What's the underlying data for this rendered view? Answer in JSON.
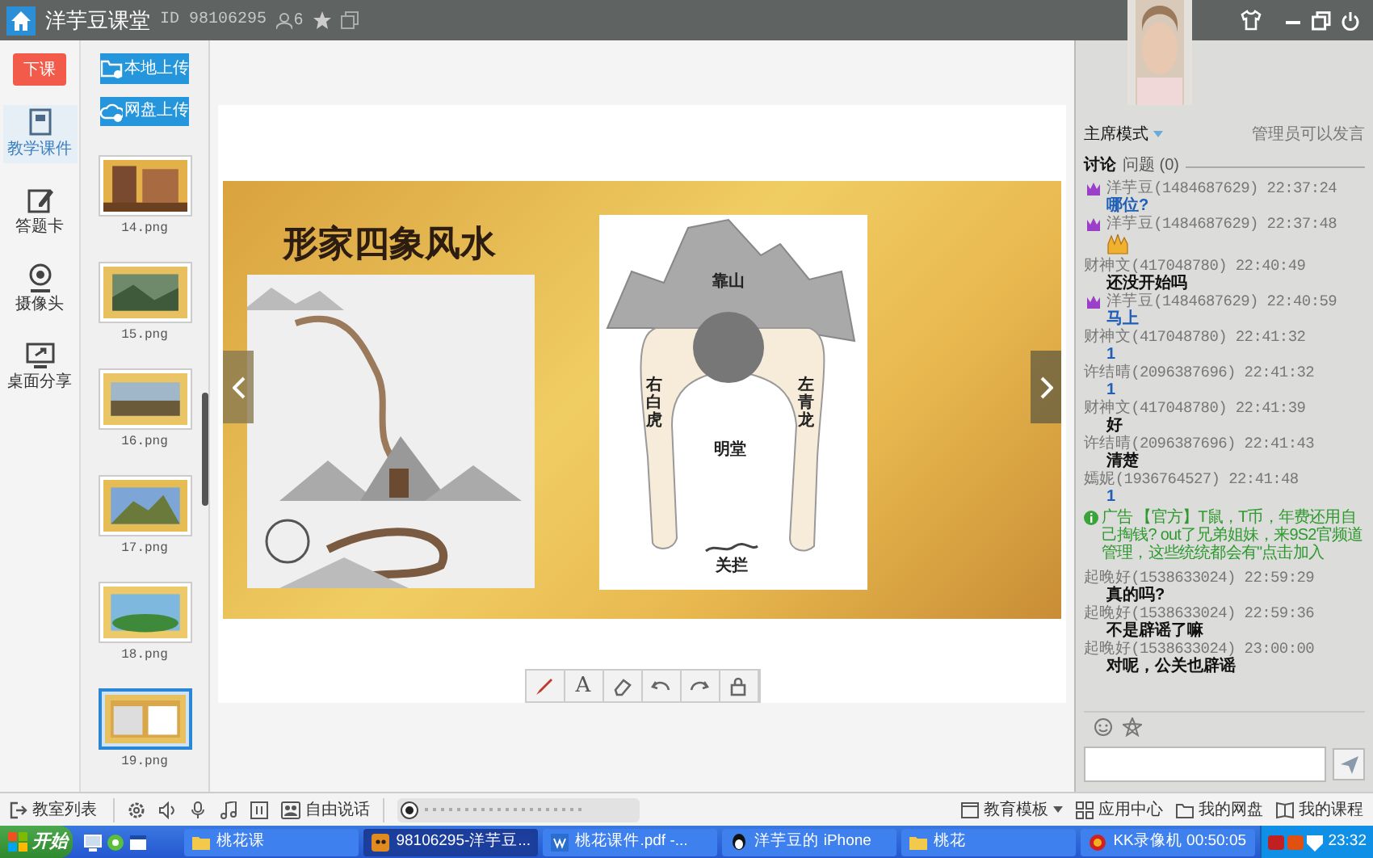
{
  "title_bar": {
    "app_name": "洋芋豆课堂",
    "room_id": "ID 98106295",
    "user_count": "6"
  },
  "left_rail": {
    "end_class_button": "下课",
    "items": [
      {
        "label": "教学课件",
        "selected": true
      },
      {
        "label": "答题卡",
        "selected": false
      },
      {
        "label": "摄像头",
        "selected": false
      },
      {
        "label": "桌面分享",
        "selected": false
      }
    ]
  },
  "upload_buttons": [
    "本地上传",
    "网盘上传"
  ],
  "thumbnails": [
    {
      "label": "14.png",
      "selected": false
    },
    {
      "label": "15.png",
      "selected": false
    },
    {
      "label": "16.png",
      "selected": false
    },
    {
      "label": "17.png",
      "selected": false
    },
    {
      "label": "18.png",
      "selected": false
    },
    {
      "label": "19.png",
      "selected": true
    }
  ],
  "slide": {
    "title": "形家四象风水",
    "diagram_labels": {
      "top": "靠山",
      "right_side": "右白虎",
      "left_side": "左青龙",
      "center": "明堂",
      "bottom": "关拦"
    }
  },
  "slide_tools": {
    "text_tool": "A"
  },
  "right_panel": {
    "mode": "主席模式",
    "permission": "管理员可以发言",
    "tabs": [
      {
        "label": "讨论",
        "selected": true
      },
      {
        "label": "问题 (0)",
        "selected": false
      }
    ],
    "messages": [
      {
        "kind": "text",
        "admin": true,
        "sender": "洋芋豆(1484687629) 22:37:24",
        "text": "哪位?",
        "color": "#1f5fb8"
      },
      {
        "kind": "sticker",
        "admin": true,
        "sender": "洋芋豆(1484687629) 22:37:48"
      },
      {
        "kind": "text",
        "admin": false,
        "sender": "财神文(417048780) 22:40:49",
        "text": "还没开始吗",
        "color": "#111111"
      },
      {
        "kind": "text",
        "admin": true,
        "sender": "洋芋豆(1484687629) 22:40:59",
        "text": "马上",
        "color": "#1f5fb8"
      },
      {
        "kind": "text",
        "admin": false,
        "sender": "财神文(417048780) 22:41:32",
        "text": "1",
        "color": "#1f5fb8"
      },
      {
        "kind": "text",
        "admin": false,
        "sender": "许结晴(2096387696) 22:41:32",
        "text": "1",
        "color": "#1f5fb8"
      },
      {
        "kind": "text",
        "admin": false,
        "sender": "财神文(417048780) 22:41:39",
        "text": "好",
        "color": "#111111"
      },
      {
        "kind": "text",
        "admin": false,
        "sender": "许结晴(2096387696) 22:41:43",
        "text": "清楚",
        "color": "#111111"
      },
      {
        "kind": "text",
        "admin": false,
        "sender": "嫣妮(1936764527) 22:41:48",
        "text": "1",
        "color": "#1f5fb8"
      },
      {
        "kind": "notice",
        "label": "广告",
        "text": "【官方】T鼠，T币，年费还用自己掏钱? out了兄弟姐妹，来9S2官频道管理，这些统统都会有\"点击加入"
      },
      {
        "kind": "text",
        "admin": false,
        "sender": "起晚好(1538633024) 22:59:29",
        "text": "真的吗?",
        "color": "#111111"
      },
      {
        "kind": "text",
        "admin": false,
        "sender": "起晚好(1538633024) 22:59:36",
        "text": "不是辟谣了嘛",
        "color": "#111111"
      },
      {
        "kind": "text",
        "admin": false,
        "sender": "起晚好(1538633024) 23:00:00",
        "text": "对呢，公关也辟谣",
        "color": "#111111"
      }
    ]
  },
  "bottom_bar": {
    "classroom_list": "教室列表",
    "free_talk": "自由说话",
    "links": [
      "教育模板",
      "应用中心",
      "我的网盘",
      "我的课程"
    ]
  },
  "taskbar": {
    "start": "开始",
    "tasks": [
      {
        "label": "桃花课",
        "selected": false
      },
      {
        "label": "98106295-洋芋豆...",
        "selected": true
      },
      {
        "label": "桃花课件.pdf -...",
        "selected": false
      },
      {
        "label": "洋芋豆的 iPhone",
        "selected": false
      },
      {
        "label": "桃花",
        "selected": false
      },
      {
        "label": "KK录像机 00:50:05",
        "selected": false
      }
    ],
    "clock": "23:32"
  }
}
